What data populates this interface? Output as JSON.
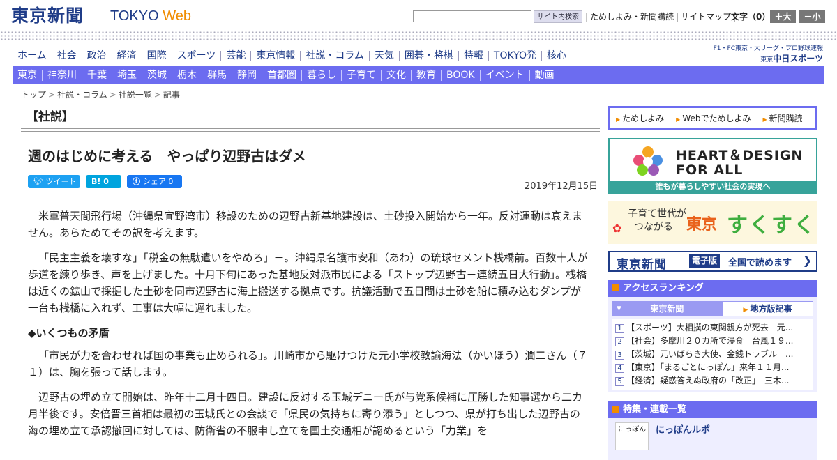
{
  "header": {
    "logo": "東京新聞",
    "brand_tokyo": "TOKYO",
    "brand_web": "Web",
    "search_button": "サイト内検索",
    "util_links": [
      "ためしよみ・新聞購読",
      "サイトマップ"
    ],
    "font_label": "文字（0）",
    "font_large": "＋大",
    "font_small": "－小"
  },
  "nav_main": [
    "ホーム",
    "社会",
    "政治",
    "経済",
    "国際",
    "スポーツ",
    "芸能",
    "東京情報",
    "社説・コラム",
    "天気",
    "囲碁・将棋",
    "特報",
    "TOKYO発",
    "核心"
  ],
  "chunichi": {
    "top": "F1・FC東京・大リーグ・プロ野球速報",
    "small": "東京",
    "name": "中日スポーツ"
  },
  "nav_region": [
    "東京",
    "神奈川",
    "千葉",
    "埼玉",
    "茨城",
    "栃木",
    "群馬",
    "静岡",
    "首都圏",
    "暮らし",
    "子育て",
    "文化",
    "教育",
    "BOOK",
    "イベント",
    "動画"
  ],
  "breadcrumb": [
    "トップ",
    "社説・コラム",
    "社説一覧",
    "記事"
  ],
  "section_title": "【社説】",
  "article": {
    "title": "週のはじめに考える　やっぱり辺野古はダメ",
    "share": {
      "tweet": "ツイート",
      "hatena": "B! 0",
      "facebook": "シェア 0"
    },
    "date": "2019年12月15日",
    "p1": "米軍普天間飛行場（沖縄県宜野湾市）移設のための辺野古新基地建設は、土砂投入開始から一年。反対運動は衰えません。あらためてその訳を考えます。",
    "p2": "「民主主義を壊すな」「税金の無駄遣いをやめろ」－。沖縄県名護市安和（あわ）の琉球セメント桟橋前。百数十人が歩道を練り歩き、声を上げました。十月下旬にあった基地反対派市民による「ストップ辺野古－連続五日大行動」。桟橋は近くの鉱山で採掘した土砂を同市辺野古に海上搬送する拠点です。抗議活動で五日間は土砂を船に積み込むダンプが一台も桟橋に入れず、工事は大幅に遅れました。",
    "h1": "◆いくつもの矛盾",
    "p3": "「市民が力を合わせれば国の事業も止められる」。川崎市から駆けつけた元小学校教諭海法（かいほう）潤二さん（７１）は、胸を張って話します。",
    "p4": "辺野古の埋め立て開始は、昨年十二月十四日。建設に反対する玉城デニー氏が与党系候補に圧勝した知事選から二カ月半後です。安倍晋三首相は最初の玉城氏との会談で「県民の気持ちに寄り添う」としつつ、県が打ち出した辺野古の海の埋め立て承認撤回に対しては、防衛省の不服申し立てを国土交通相が認めるという「力業」を"
  },
  "sidebar": {
    "trial": [
      "ためしよみ",
      "Webでためしよみ",
      "新聞購読"
    ],
    "hd_line1": "HEART＆DESIGN",
    "hd_line2": "FOR ALL",
    "hd_caption": "誰もが暮らしやすい社会の実現へ",
    "kids_line1": "子育て世代が",
    "kids_line2": "つながる",
    "kids_tokyo": "東京",
    "kids_name": "すくすく",
    "e_logo": "東京新聞",
    "e_badge": "電子版",
    "e_text": "全国で読めます",
    "ranking_title": "アクセスランキング",
    "tab_tokyo": "東京新聞",
    "tab_local": "地方版記事",
    "ranking": [
      {
        "n": "1",
        "text": "【スポーツ】大相撲の東関親方が死去　元..."
      },
      {
        "n": "2",
        "text": "【社会】多摩川２０カ所で浸食　台風１９..."
      },
      {
        "n": "3",
        "text": "【茨城】元いばらき大使、金銭トラブル　..."
      },
      {
        "n": "4",
        "text": "【東京】「まるごとにっぽん」来年１１月..."
      },
      {
        "n": "5",
        "text": "【経済】疑惑答えぬ政府の「改正」　三木..."
      }
    ],
    "series_title": "特集・連載一覧",
    "series_item": "にっぽんルポ",
    "series_thumb": "にっぽん"
  },
  "colors": {
    "navy": "#1f3c88",
    "accent": "#f08c00",
    "nav_bg": "#6c6cf0",
    "teal": "#37a39a"
  }
}
